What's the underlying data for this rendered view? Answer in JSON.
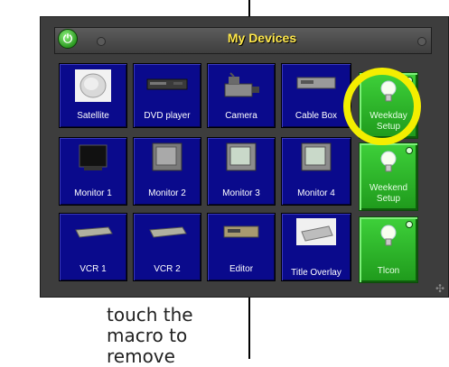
{
  "window": {
    "title": "My Devices"
  },
  "devices": [
    {
      "label": "Satellite",
      "icon": "satellite-dish-icon"
    },
    {
      "label": "DVD player",
      "icon": "dvd-player-icon"
    },
    {
      "label": "Camera",
      "icon": "camera-icon"
    },
    {
      "label": "Cable Box",
      "icon": "cable-box-icon"
    },
    {
      "label": "Monitor 1",
      "icon": "monitor-icon"
    },
    {
      "label": "Monitor 2",
      "icon": "monitor-icon"
    },
    {
      "label": "Monitor 3",
      "icon": "monitor-icon"
    },
    {
      "label": "Monitor 4",
      "icon": "monitor-icon"
    },
    {
      "label": "VCR 1",
      "icon": "vcr-icon"
    },
    {
      "label": "VCR 2",
      "icon": "vcr-icon"
    },
    {
      "label": "Editor",
      "icon": "editor-deck-icon"
    },
    {
      "label": "Title Overlay",
      "icon": "title-overlay-icon"
    }
  ],
  "macros": [
    {
      "label": "Weekday Setup",
      "icon": "light-bulb-icon",
      "highlighted": true
    },
    {
      "label": "Weekend Setup",
      "icon": "light-bulb-icon"
    },
    {
      "label": "Tlcon",
      "icon": "light-bulb-icon"
    }
  ],
  "caption": "touch the macro to remove",
  "colors": {
    "device_tile": "#0a0a8c",
    "macro_tile": "#2fb82c",
    "title_text": "#ffe84a",
    "highlight_ring": "#f4ee00"
  }
}
